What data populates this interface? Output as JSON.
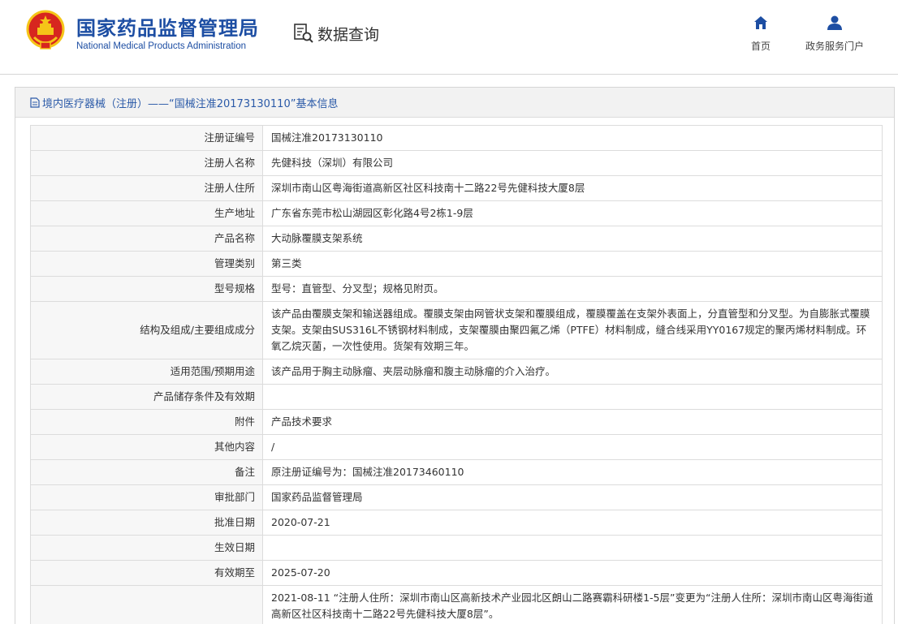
{
  "header": {
    "org_name_cn": "国家药品监督管理局",
    "org_name_en": "National Medical Products Administration",
    "query_title": "数据查询",
    "nav": [
      {
        "label": "首页",
        "icon": "home-icon"
      },
      {
        "label": "政务服务门户",
        "icon": "user-icon"
      }
    ]
  },
  "panel": {
    "title": "境内医疗器械（注册）——“国械注准20173130110”基本信息",
    "icon": "document-icon"
  },
  "rows": [
    {
      "label": "注册证编号",
      "value": "国械注准20173130110"
    },
    {
      "label": "注册人名称",
      "value": "先健科技（深圳）有限公司"
    },
    {
      "label": "注册人住所",
      "value": "深圳市南山区粤海街道高新区社区科技南十二路22号先健科技大厦8层"
    },
    {
      "label": "生产地址",
      "value": "广东省东莞市松山湖园区彰化路4号2栋1-9层"
    },
    {
      "label": "产品名称",
      "value": "大动脉覆膜支架系统"
    },
    {
      "label": "管理类别",
      "value": "第三类"
    },
    {
      "label": "型号规格",
      "value": "型号：直管型、分叉型；规格见附页。"
    },
    {
      "label": "结构及组成/主要组成成分",
      "value": "该产品由覆膜支架和输送器组成。覆膜支架由网管状支架和覆膜组成，覆膜覆盖在支架外表面上，分直管型和分叉型。为自膨胀式覆膜支架。支架由SUS316L不锈钢材料制成，支架覆膜由聚四氟乙烯（PTFE）材料制成，缝合线采用YY0167规定的聚丙烯材料制成。环氧乙烷灭菌，一次性使用。货架有效期三年。"
    },
    {
      "label": "适用范围/预期用途",
      "value": "该产品用于胸主动脉瘤、夹层动脉瘤和腹主动脉瘤的介入治疗。"
    },
    {
      "label": "产品储存条件及有效期",
      "value": ""
    },
    {
      "label": "附件",
      "value": "产品技术要求"
    },
    {
      "label": "其他内容",
      "value": "/"
    },
    {
      "label": "备注",
      "value": "原注册证编号为：国械注准20173460110"
    },
    {
      "label": "审批部门",
      "value": "国家药品监督管理局"
    },
    {
      "label": "批准日期",
      "value": "2020-07-21"
    },
    {
      "label": "生效日期",
      "value": ""
    },
    {
      "label": "有效期至",
      "value": "2025-07-20"
    },
    {
      "label": "",
      "value": "2021-08-11 “注册人住所：深圳市南山区高新技术产业园北区朗山二路赛霸科研楼1-5层”变更为“注册人住所：深圳市南山区粤海街道高新区社区科技南十二路22号先健科技大厦8层”。"
    }
  ],
  "colors": {
    "brand_blue": "#1d4ea3",
    "emblem_red": "#d7261f",
    "emblem_gold": "#f5c518",
    "link_blue": "#2b5aa8"
  }
}
